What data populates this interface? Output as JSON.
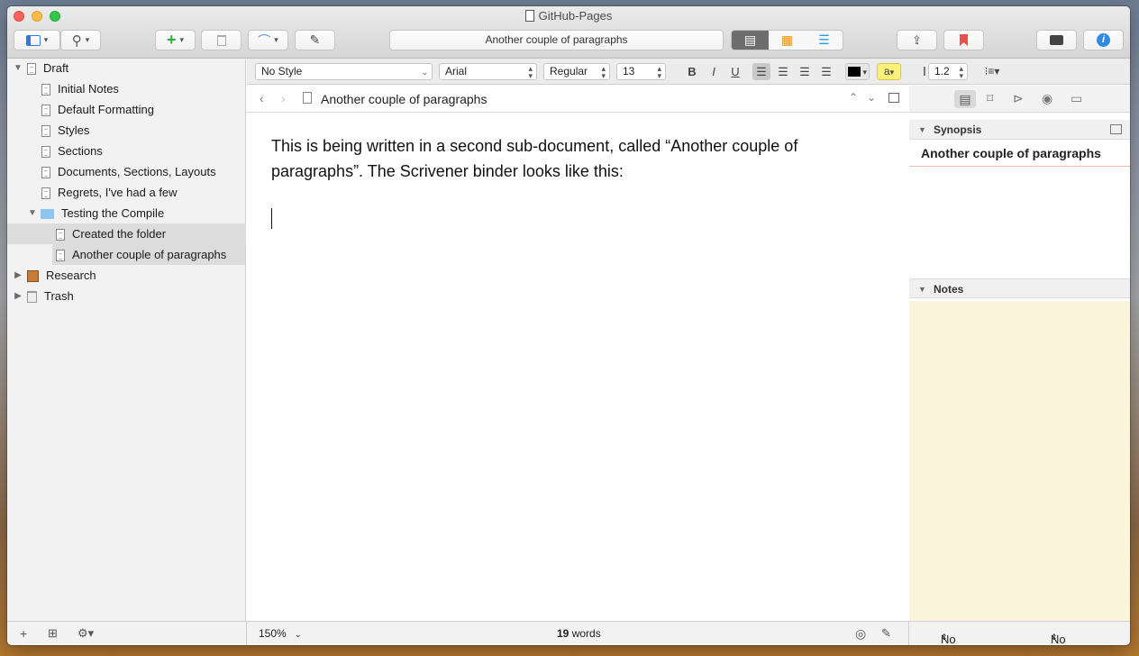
{
  "window": {
    "title": "GitHub-Pages"
  },
  "toolbar": {
    "address_title": "Another couple of paragraphs"
  },
  "binder": {
    "items": [
      {
        "label": "Draft",
        "type": "draft",
        "level": 0,
        "expanded": true
      },
      {
        "label": "Initial Notes",
        "type": "doc",
        "level": 1
      },
      {
        "label": "Default Formatting",
        "type": "doc",
        "level": 1
      },
      {
        "label": "Styles",
        "type": "doc",
        "level": 1
      },
      {
        "label": "Sections",
        "type": "doc",
        "level": 1
      },
      {
        "label": "Documents, Sections, Layouts",
        "type": "doc",
        "level": 1
      },
      {
        "label": "Regrets, I've had a few",
        "type": "doc",
        "level": 1
      },
      {
        "label": "Testing the Compile",
        "type": "folder",
        "level": 1,
        "expanded": true
      },
      {
        "label": "Created the folder",
        "type": "doc",
        "level": 2,
        "selected": true
      },
      {
        "label": "Another couple of paragraphs",
        "type": "doc",
        "level": 2,
        "selected": true
      },
      {
        "label": "Research",
        "type": "research",
        "level": 0,
        "expanded": false
      },
      {
        "label": "Trash",
        "type": "trash",
        "level": 0,
        "expanded": false
      }
    ]
  },
  "format_bar": {
    "style": "No Style",
    "font": "Arial",
    "weight": "Regular",
    "size": "13",
    "bold": "B",
    "italic": "I",
    "underline": "U",
    "highlight_label": "a",
    "line_spacing": "1.2",
    "text_color": "#000000",
    "highlight_color": "#fbf07a"
  },
  "editor": {
    "header_title": "Another couple of paragraphs",
    "body": "This is being written in a second sub-document, called “Another couple of paragraphs”. The Scrivener binder looks like this:",
    "zoom": "150%",
    "word_count": "19",
    "word_label": "words"
  },
  "inspector": {
    "synopsis_label": "Synopsis",
    "synopsis_title": "Another couple of paragraphs",
    "notes_label": "Notes",
    "label_value": "No Label",
    "status_value": "No Status"
  }
}
